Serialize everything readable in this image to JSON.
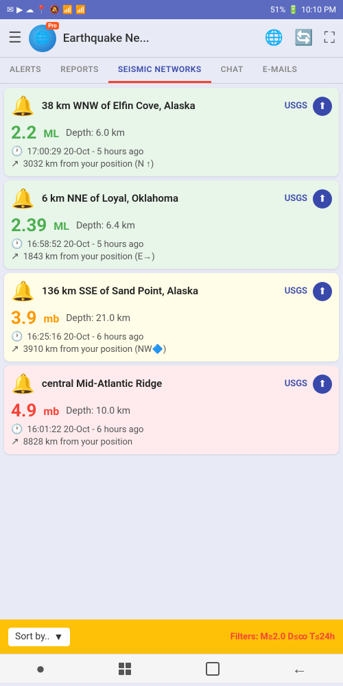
{
  "statusBar": {
    "leftIcons": [
      "✉",
      "▶",
      "☁"
    ],
    "rightText": "51%",
    "time": "10:10 PM",
    "batteryIcon": "🔋"
  },
  "appBar": {
    "title": "Earthquake Ne...",
    "proBadge": "Pro"
  },
  "tabs": [
    {
      "label": "ALERTS",
      "active": false
    },
    {
      "label": "REPORTS",
      "active": false
    },
    {
      "label": "SEISMIC NETWORKS",
      "active": true
    },
    {
      "label": "CHAT",
      "active": false
    },
    {
      "label": "E-MAILS",
      "active": false
    }
  ],
  "earthquakes": [
    {
      "id": 1,
      "location": "38 km WNW of Elfin Cove, Alaska",
      "source": "USGS",
      "magnitude": "2.2",
      "magnitudeType": "ML",
      "magnitudeColor": "mag-green",
      "depth": "Depth: 6.0 km",
      "time": "17:00:29 20-Oct - 5 hours ago",
      "distance": "3032 km from your position (N ↑)",
      "cardClass": "card-green",
      "icon": "🔔"
    },
    {
      "id": 2,
      "location": "6 km NNE of Loyal, Oklahoma",
      "source": "USGS",
      "magnitude": "2.39",
      "magnitudeType": "ML",
      "magnitudeColor": "mag-green",
      "depth": "Depth: 6.4 km",
      "time": "16:58:52 20-Oct - 5 hours ago",
      "distance": "1843 km from your position (E→)",
      "cardClass": "card-green",
      "icon": "🔔"
    },
    {
      "id": 3,
      "location": "136 km SSE of Sand Point, Alaska",
      "source": "USGS",
      "magnitude": "3.9",
      "magnitudeType": "mb",
      "magnitudeColor": "mag-orange",
      "depth": "Depth: 21.0 km",
      "time": "16:25:16 20-Oct - 6 hours ago",
      "distance": "3910 km from your position (NW🔷)",
      "cardClass": "card-yellow",
      "icon": "🔔"
    },
    {
      "id": 4,
      "location": "central Mid-Atlantic Ridge",
      "source": "USGS",
      "magnitude": "4.9",
      "magnitudeType": "mb",
      "magnitudeColor": "mag-red",
      "depth": "Depth: 10.0 km",
      "time": "16:01:22 20-Oct - 6 hours ago",
      "distance": "8828 km from your position",
      "cardClass": "card-red-light",
      "icon": "🔔"
    }
  ],
  "bottomBar": {
    "sortLabel": "Sort by..",
    "filterText": "Filters: M≥",
    "filterMag": "2.0",
    "filterDist": "D≤∞ T≤24h"
  },
  "navBar": {
    "buttons": [
      "●",
      "⬛",
      "⬜",
      "←"
    ]
  }
}
